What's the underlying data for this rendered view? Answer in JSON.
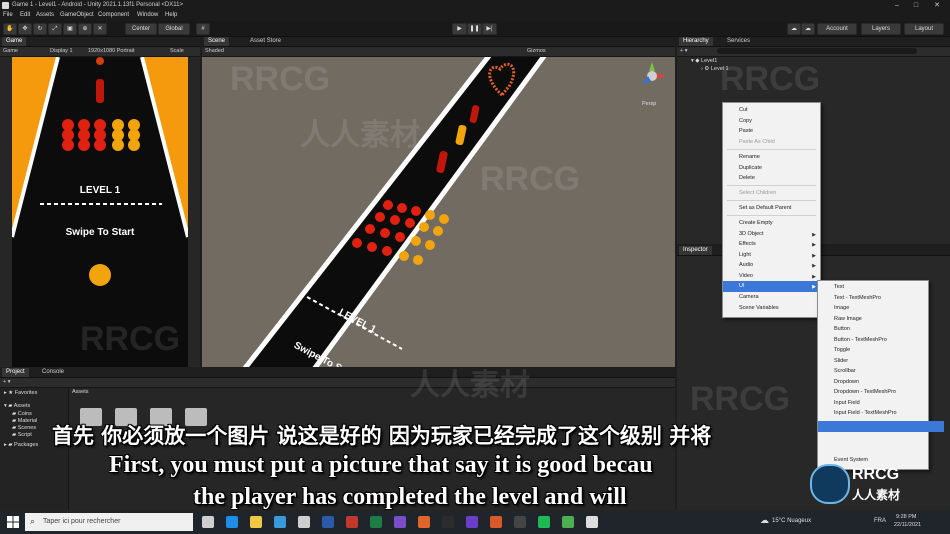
{
  "window": {
    "title": "Game 1 - Level1 - Android - Unity 2021.1.13f1 Personal <DX11>"
  },
  "menu": [
    "File",
    "Edit",
    "Assets",
    "GameObject",
    "Component",
    "Window",
    "Help"
  ],
  "toolbar": {
    "center": "Center",
    "global": "Global",
    "account": "Account",
    "layers": "Layers",
    "layout": "Layout"
  },
  "game_panel": {
    "tab": "Game",
    "sub_game": "Game",
    "display": "Display 1",
    "resolution": "1920x1080 Portrait",
    "scale": "Scale",
    "level_text": "LEVEL 1",
    "swipe_text": "Swipe To Start"
  },
  "scene_panel": {
    "tabs": [
      "Scene",
      "Asset Store"
    ],
    "shading": "Shaded",
    "gizmos": "Gizmos",
    "persp": "Persp",
    "level_text": "LEVEL 1",
    "swipe_text": "Swipe To S"
  },
  "hierarchy": {
    "tabs": [
      "Hierarchy",
      "Services"
    ],
    "scene_item": "Level1",
    "child_item": "Level 1"
  },
  "inspector": {
    "tab": "Inspector"
  },
  "context_menu": {
    "items": [
      {
        "label": "Cut",
        "disabled": false
      },
      {
        "label": "Copy",
        "disabled": false
      },
      {
        "label": "Paste",
        "disabled": false
      },
      {
        "label": "Paste As Child",
        "disabled": true
      },
      {
        "label": "Rename",
        "disabled": false
      },
      {
        "label": "Duplicate",
        "disabled": false
      },
      {
        "label": "Delete",
        "disabled": false
      },
      {
        "label": "Select Children",
        "disabled": true
      },
      {
        "label": "Set as Default Parent",
        "disabled": false
      },
      {
        "label": "Create Empty",
        "disabled": false
      },
      {
        "label": "3D Object",
        "disabled": false
      },
      {
        "label": "Effects",
        "disabled": false
      },
      {
        "label": "Light",
        "disabled": false
      },
      {
        "label": "Audio",
        "disabled": false
      },
      {
        "label": "Video",
        "disabled": false
      },
      {
        "label": "UI",
        "disabled": false
      },
      {
        "label": "Camera",
        "disabled": false
      },
      {
        "label": "Scene Variables",
        "disabled": false
      }
    ]
  },
  "ui_submenu": {
    "items": [
      "Text",
      "Text - TextMeshPro",
      "Image",
      "Raw Image",
      "Button",
      "Button - TextMeshPro",
      "Toggle",
      "Slider",
      "Scrollbar",
      "Dropdown",
      "Dropdown - TextMeshPro",
      "Input Field",
      "Input Field - TextMeshPro",
      "",
      "Event System"
    ]
  },
  "project_panel": {
    "tabs": [
      "Project",
      "Console"
    ],
    "favorites": "Favorites",
    "assets_root": "Assets",
    "folders": [
      "Coins",
      "Material",
      "Scenes",
      "Script"
    ],
    "packages": "Packages",
    "breadcrumb": "Assets"
  },
  "subtitles": {
    "chinese": "首先 你必须放一个图片 说这是好的 因为玩家已经完成了这个级别 并将",
    "english_1": "First, you must put a picture that say it is good becau",
    "english_2": "the player has completed the level and will"
  },
  "watermarks": {
    "rrcg": "RRCG",
    "cn": "人人素材"
  },
  "logo": {
    "top": "RRCG",
    "bottom": "人人素材"
  },
  "taskbar": {
    "search_placeholder": "Taper ici pour rechercher",
    "weather": "15°C Nuageux",
    "lang": "FRA",
    "time": "9:28 PM",
    "date": "22/11/2021"
  },
  "colors": {
    "accent_blue": "#3b78d8",
    "game_bg": "#f59a0c",
    "track_black": "#0c0c0c"
  }
}
